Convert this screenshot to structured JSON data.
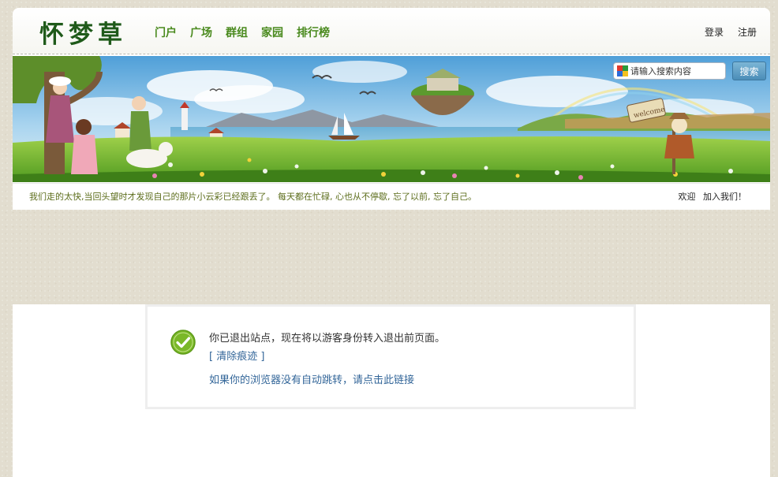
{
  "site": {
    "logo": "怀梦草",
    "nav": [
      "门户",
      "广场",
      "群组",
      "家园",
      "排行榜"
    ],
    "login_label": "登录",
    "register_label": "注册"
  },
  "search": {
    "placeholder": "请输入搜索内容",
    "button_label": "搜索",
    "icon": "search-engine-icon"
  },
  "banner": {
    "sign_text": "welcome"
  },
  "tagline": "我们走的太快,当回头望时才发现自己的那片小云彩已经跟丢了。 每天都在忙碌, 心也从不停歇, 忘了以前, 忘了自己。",
  "welcome": {
    "greeting": "欢迎",
    "join_label": "加入我们！"
  },
  "message": {
    "icon": "success-check-icon",
    "text": "你已退出站点，现在将以游客身份转入退出前页面。",
    "clear_link": "[ 清除痕迹 ]",
    "redirect_link": "如果你的浏览器没有自动跳转，请点击此链接"
  },
  "colors": {
    "nav_green": "#4a8a1e",
    "logo_green": "#1f5a1a",
    "link_blue": "#336699",
    "search_button": "#4b8db8",
    "success_green": "#7ab828"
  }
}
